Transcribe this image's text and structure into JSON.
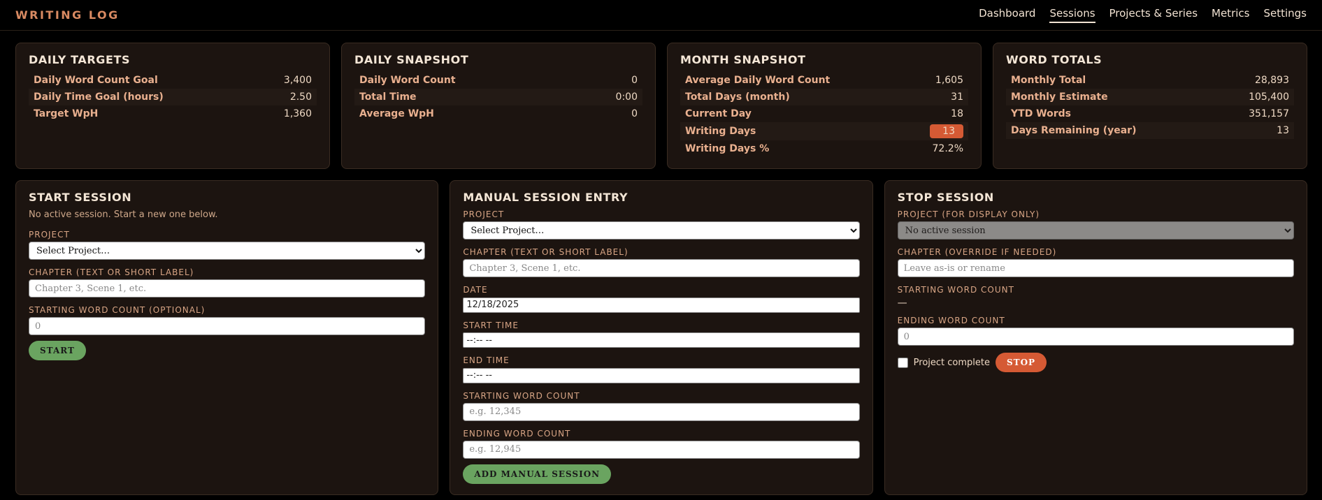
{
  "brand": "WRITING LOG",
  "nav": [
    "Dashboard",
    "Sessions",
    "Projects & Series",
    "Metrics",
    "Settings"
  ],
  "nav_active": "Sessions",
  "cards": {
    "daily_targets": {
      "title": "DAILY TARGETS",
      "rows": [
        {
          "label": "Daily Word Count Goal",
          "value": "3,400"
        },
        {
          "label": "Daily Time Goal (hours)",
          "value": "2.50"
        },
        {
          "label": "Target WpH",
          "value": "1,360"
        }
      ]
    },
    "daily_snapshot": {
      "title": "DAILY SNAPSHOT",
      "rows": [
        {
          "label": "Daily Word Count",
          "value": "0"
        },
        {
          "label": "Total Time",
          "value": "0:00"
        },
        {
          "label": "Average WpH",
          "value": "0"
        }
      ]
    },
    "month_snapshot": {
      "title": "MONTH SNAPSHOT",
      "rows": [
        {
          "label": "Average Daily Word Count",
          "value": "1,605"
        },
        {
          "label": "Total Days (month)",
          "value": "31"
        },
        {
          "label": "Current Day",
          "value": "18"
        },
        {
          "label": "Writing Days",
          "value": "13"
        },
        {
          "label": "Writing Days %",
          "value": "72.2%"
        }
      ]
    },
    "word_totals": {
      "title": "WORD TOTALS",
      "rows": [
        {
          "label": "Monthly Total",
          "value": "28,893"
        },
        {
          "label": "Monthly Estimate",
          "value": "105,400"
        },
        {
          "label": "YTD Words",
          "value": "351,157"
        },
        {
          "label": "Days Remaining (year)",
          "value": "13"
        }
      ]
    }
  },
  "start_session": {
    "title": "START SESSION",
    "note": "No active session. Start a new one below.",
    "project_label": "PROJECT",
    "project_value": "Select Project…",
    "chapter_label": "CHAPTER (TEXT OR SHORT LABEL)",
    "chapter_placeholder": "Chapter 3, Scene 1, etc.",
    "start_wc_label": "STARTING WORD COUNT (OPTIONAL)",
    "start_wc_placeholder": "0",
    "button": "START"
  },
  "manual": {
    "title": "MANUAL SESSION ENTRY",
    "project_label": "PROJECT",
    "project_value": "Select Project…",
    "chapter_label": "CHAPTER (TEXT OR SHORT LABEL)",
    "chapter_placeholder": "Chapter 3, Scene 1, etc.",
    "date_label": "DATE",
    "date_value": "12/18/2025",
    "start_time_label": "START TIME",
    "start_time_value": "--:-- --",
    "end_time_label": "END TIME",
    "end_time_value": "--:-- --",
    "start_wc_label": "STARTING WORD COUNT",
    "start_wc_placeholder": "e.g. 12,345",
    "end_wc_label": "ENDING WORD COUNT",
    "end_wc_placeholder": "e.g. 12,945",
    "button": "ADD MANUAL SESSION"
  },
  "stop": {
    "title": "STOP SESSION",
    "project_label": "PROJECT (FOR DISPLAY ONLY)",
    "project_value": "No active session",
    "chapter_label": "CHAPTER (OVERRIDE IF NEEDED)",
    "chapter_placeholder": "Leave as-is or rename",
    "start_wc_label": "STARTING WORD COUNT",
    "start_wc_value": "—",
    "end_wc_label": "ENDING WORD COUNT",
    "end_wc_placeholder": "0",
    "complete_label": "Project complete",
    "button": "STOP"
  },
  "colors": {
    "accent_orange": "#d55a34",
    "accent_green": "#6aa460",
    "card_bg": "#1c1410"
  }
}
